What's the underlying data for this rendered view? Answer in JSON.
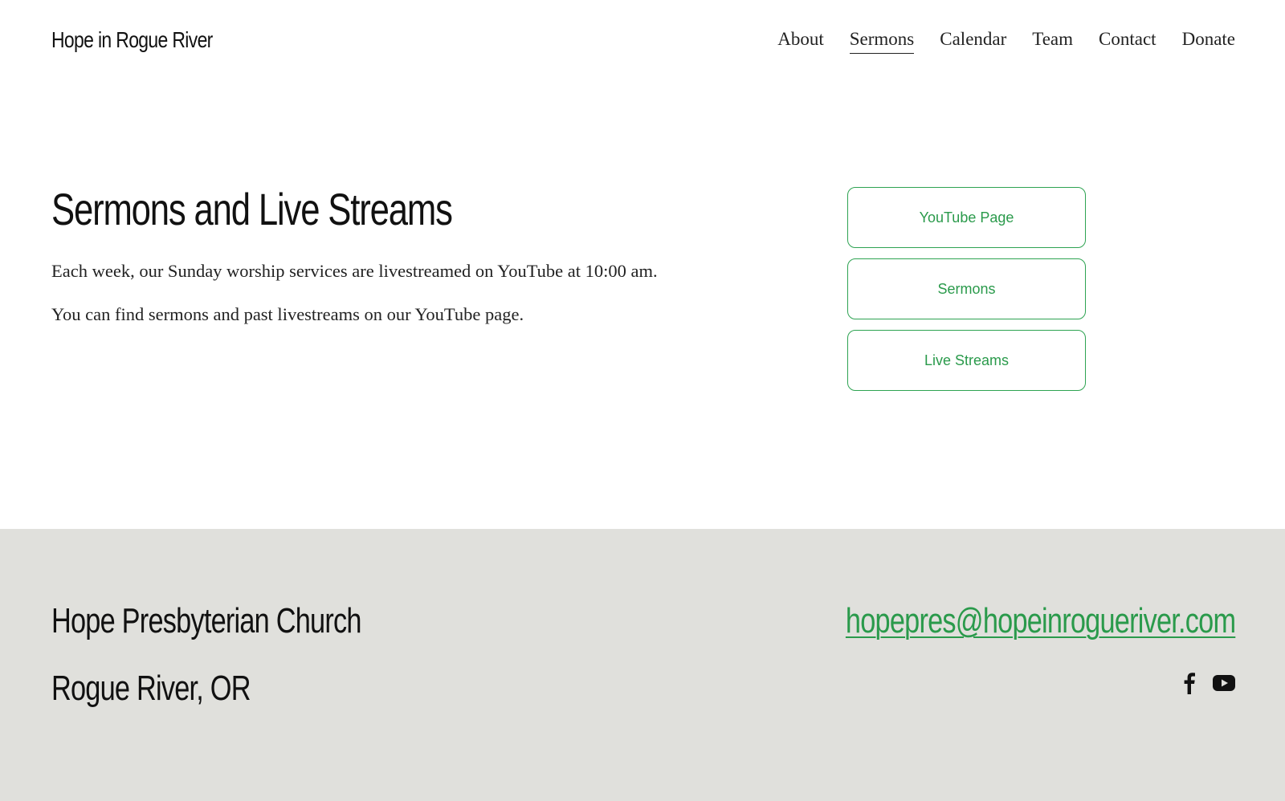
{
  "header": {
    "site_title": "Hope in Rogue River",
    "nav": [
      {
        "label": "About",
        "active": false
      },
      {
        "label": "Sermons",
        "active": true
      },
      {
        "label": "Calendar",
        "active": false
      },
      {
        "label": "Team",
        "active": false
      },
      {
        "label": "Contact",
        "active": false
      },
      {
        "label": "Donate",
        "active": false
      }
    ]
  },
  "main": {
    "heading": "Sermons and Live Streams",
    "paragraphs": [
      "Each week, our Sunday worship services are livestreamed on YouTube at 10:00 am.",
      "You can find sermons and past livestreams on our YouTube page."
    ],
    "buttons": [
      {
        "label": "YouTube Page"
      },
      {
        "label": "Sermons"
      },
      {
        "label": "Live Streams"
      }
    ]
  },
  "footer": {
    "name": "Hope Presbyterian Church",
    "location": "Rogue River, OR",
    "email": "hopepres@hopeinrogueriver.com",
    "social": [
      "facebook-icon",
      "youtube-icon"
    ]
  },
  "colors": {
    "accent": "#2a9a4b",
    "footer_bg": "#e0e0dc",
    "text": "#111111"
  }
}
